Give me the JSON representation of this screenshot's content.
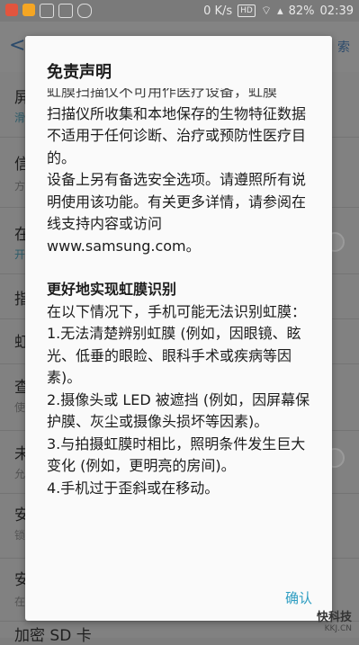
{
  "status_bar": {
    "speed": "0 K/s",
    "hd": "HD",
    "battery": "82%",
    "time": "02:39",
    "colors": {
      "icon1": "#f5a623",
      "icon2": "#e2553e"
    }
  },
  "background": {
    "search_label": "索",
    "rows": [
      {
        "title": "屏",
        "sub": "滑"
      },
      {
        "title": "信",
        "sub": "方"
      },
      {
        "title": "在",
        "sub": "开"
      },
      {
        "title": "指",
        "sub": ""
      },
      {
        "title": "虹",
        "sub": ""
      },
      {
        "title": "查",
        "sub": "使"
      },
      {
        "title": "未",
        "sub": "允"
      },
      {
        "title": "安",
        "sub": "锁"
      },
      {
        "title": "安",
        "sub": "在"
      }
    ],
    "bottom_item": "加密 SD 卡"
  },
  "dialog": {
    "title": "免责声明",
    "cut_line": "虹膜扫描仪不可用作医疗设备，虹膜",
    "paragraphs": [
      "扫描仪所收集和本地保存的生物特征数据不适用于任何诊断、治疗或预防性医疗目的。",
      "设备上另有备选安全选项。请遵照所有说明使用该功能。有关更多详情，请参阅在线支持内容或访问www.samsung.com。"
    ],
    "section_title": "更好地实现虹膜识别",
    "section_intro": "在以下情况下，手机可能无法识别虹膜：",
    "items": [
      "1.无法清楚辨别虹膜 (例如，因眼镜、眩光、低垂的眼睑、眼科手术或疾病等因素)。",
      "2.摄像头或 LED 被遮挡 (例如，因屏幕保护膜、灰尘或摄像头损坏等因素)。",
      "3.与拍摄虹膜时相比，照明条件发生巨大变化 (例如，更明亮的房间)。",
      "4.手机过于歪斜或在移动。"
    ],
    "confirm_label": "确认"
  },
  "watermark": {
    "line1": "快科技",
    "line2": "KKJ.CN"
  }
}
